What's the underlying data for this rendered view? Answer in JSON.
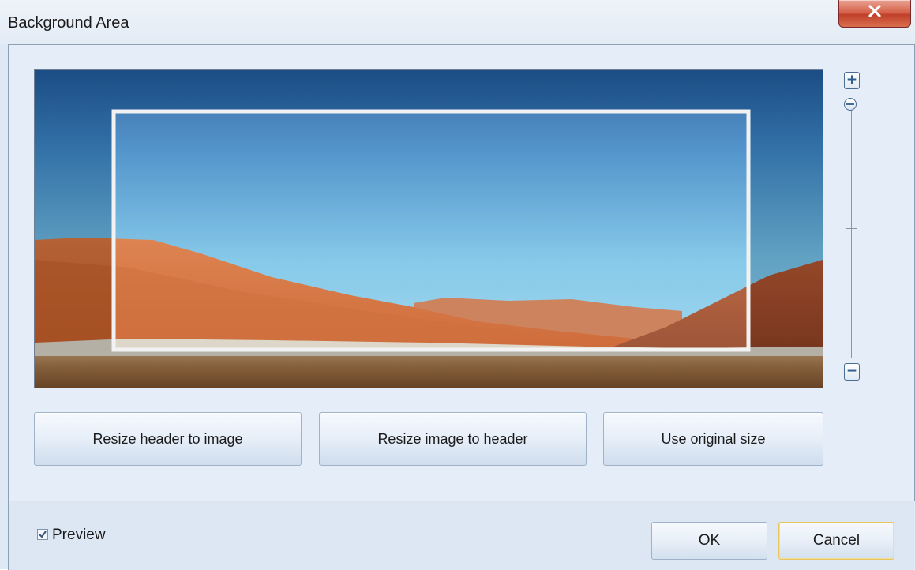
{
  "window": {
    "title": "Background Area",
    "close_icon": "close-icon"
  },
  "zoom": {
    "plus_label": "+",
    "minus_label": "−"
  },
  "actions": {
    "resize_header_label": "Resize header to image",
    "resize_image_label": "Resize image to header",
    "original_size_label": "Use original size"
  },
  "footer": {
    "preview_label": "Preview",
    "preview_checked": true,
    "ok_label": "OK",
    "cancel_label": "Cancel"
  },
  "colors": {
    "dialog_bg": "#dfe9f5",
    "close_red": "#c0402a",
    "default_button_border": "#e8c65c"
  }
}
